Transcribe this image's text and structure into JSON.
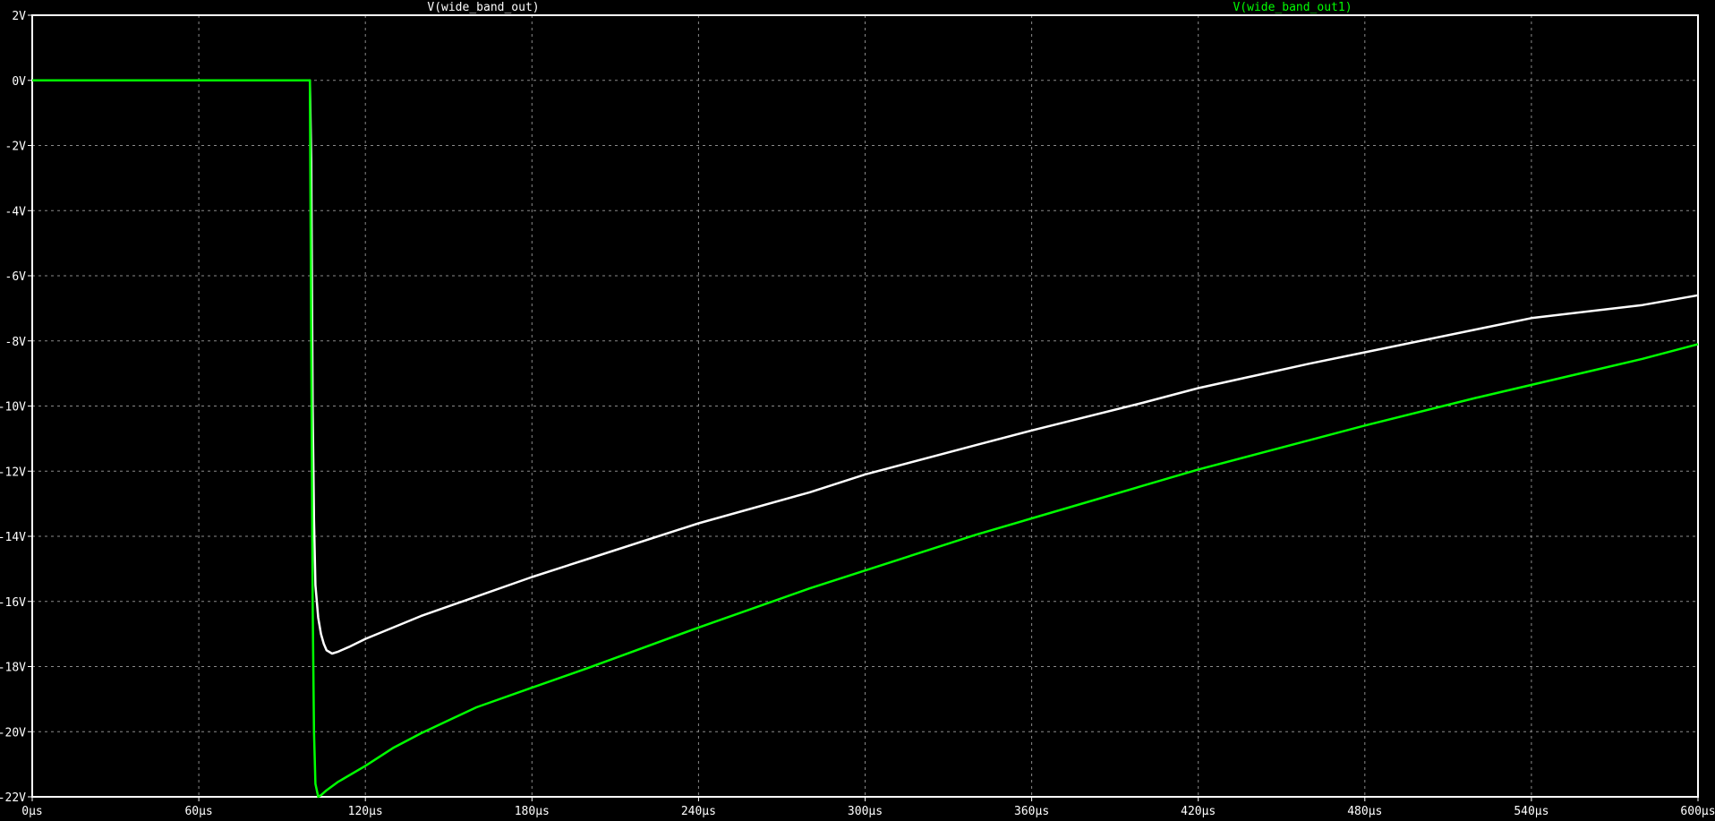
{
  "chart_data": {
    "type": "line",
    "title": "",
    "xlabel": "",
    "ylabel": "",
    "xlim": [
      0,
      600
    ],
    "ylim": [
      -22,
      2
    ],
    "grid": true,
    "legend": "top",
    "x_ticks": [
      0,
      60,
      120,
      180,
      240,
      300,
      360,
      420,
      480,
      540,
      600
    ],
    "x_tick_labels": [
      "0µs",
      "60µs",
      "120µs",
      "180µs",
      "240µs",
      "300µs",
      "360µs",
      "420µs",
      "480µs",
      "540µs",
      "600µs"
    ],
    "y_ticks": [
      2,
      0,
      -2,
      -4,
      -6,
      -8,
      -10,
      -12,
      -14,
      -16,
      -18,
      -20,
      -22
    ],
    "y_tick_labels": [
      "2V",
      "0V",
      "-2V",
      "-4V",
      "-6V",
      "-8V",
      "-10V",
      "-12V",
      "-14V",
      "-16V",
      "-18V",
      "-20V",
      "-22V"
    ],
    "series": [
      {
        "name": "V(wide_band_out)",
        "color": "#ffffff",
        "x": [
          0,
          100,
          100.5,
          101,
          101.5,
          102,
          103,
          104,
          105,
          106,
          108,
          110,
          114,
          120,
          130,
          140,
          160,
          180,
          200,
          240,
          280,
          300,
          340,
          360,
          400,
          420,
          460,
          480,
          520,
          540,
          580,
          600
        ],
        "y": [
          0,
          0,
          -2.5,
          -10,
          -13.5,
          -15.5,
          -16.5,
          -17.0,
          -17.3,
          -17.5,
          -17.6,
          -17.55,
          -17.4,
          -17.15,
          -16.8,
          -16.45,
          -15.85,
          -15.25,
          -14.7,
          -13.6,
          -12.65,
          -12.1,
          -11.2,
          -10.75,
          -9.9,
          -9.45,
          -8.7,
          -8.35,
          -7.65,
          -7.3,
          -6.9,
          -6.6
        ]
      },
      {
        "name": "V(wide_band_out1)",
        "color": "#00ff00",
        "x": [
          0,
          100,
          100.5,
          101,
          101.5,
          102,
          103,
          104,
          106,
          110,
          120,
          130,
          140,
          160,
          180,
          200,
          240,
          280,
          300,
          340,
          360,
          400,
          420,
          460,
          480,
          520,
          540,
          580,
          600
        ],
        "y": [
          0,
          0,
          -8,
          -16,
          -20,
          -21.6,
          -22.0,
          -21.95,
          -21.8,
          -21.55,
          -21.05,
          -20.5,
          -20.05,
          -19.25,
          -18.65,
          -18.05,
          -16.8,
          -15.6,
          -15.05,
          -13.95,
          -13.45,
          -12.45,
          -11.95,
          -11.05,
          -10.6,
          -9.75,
          -9.35,
          -8.55,
          -8.1
        ]
      }
    ]
  }
}
